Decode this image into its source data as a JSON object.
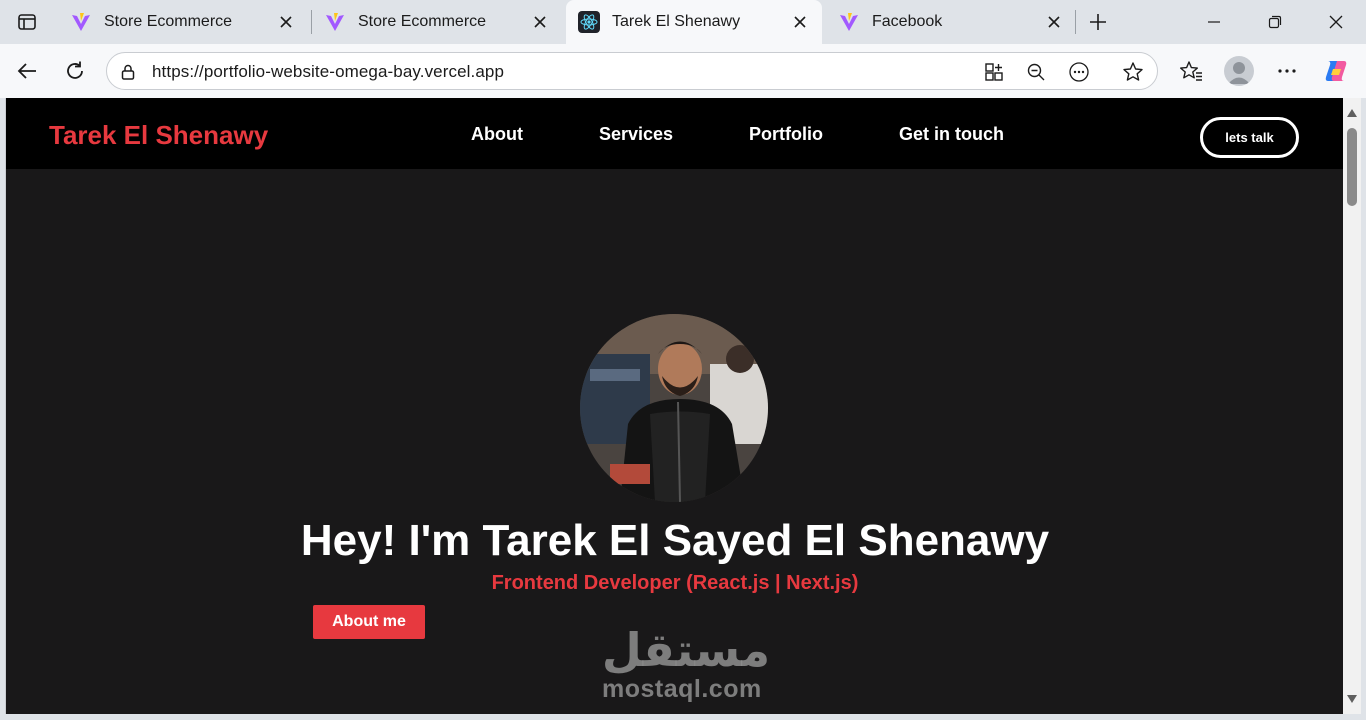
{
  "tabs": [
    {
      "title": "Store Ecommerce",
      "icon": "vite-icon"
    },
    {
      "title": "Store Ecommerce",
      "icon": "vite-icon"
    },
    {
      "title": "Tarek El Shenawy",
      "icon": "react-icon"
    },
    {
      "title": "Facebook",
      "icon": "vite-icon"
    }
  ],
  "address_bar": {
    "url": "https://portfolio-website-omega-bay.vercel.app"
  },
  "site": {
    "brand": "Tarek El Shenawy",
    "nav": [
      "About",
      "Services",
      "Portfolio",
      "Get in touch"
    ],
    "cta": "lets talk",
    "hero_title": "Hey! I'm Tarek El Sayed El Shenawy",
    "hero_subtitle": "Frontend Developer (React.js | Next.js)",
    "about_button": "About me"
  },
  "watermark": {
    "arabic": "مستقل",
    "latin": "mostaql.com"
  },
  "colors": {
    "accent": "#e7393f",
    "page_bg": "#191819",
    "nav_bg": "#000000"
  }
}
